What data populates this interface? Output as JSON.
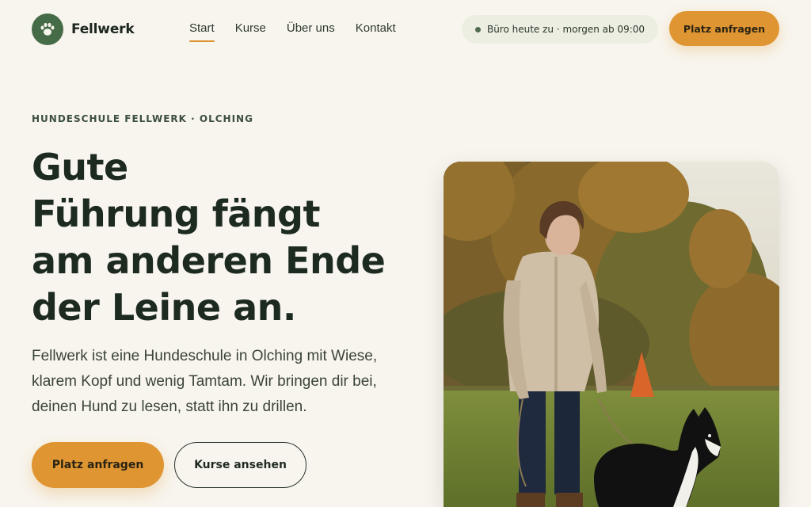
{
  "brand": {
    "name": "Fellwerk",
    "logo_icon": "paw-icon",
    "logo_color": "#466b47"
  },
  "nav": [
    {
      "label": "Start",
      "active": true
    },
    {
      "label": "Kurse",
      "active": false
    },
    {
      "label": "Über uns",
      "active": false
    },
    {
      "label": "Kontakt",
      "active": false
    }
  ],
  "status": {
    "text": "Büro heute zu · morgen ab 09:00",
    "dot_color": "#4f6b50"
  },
  "header_cta": {
    "label": "Platz anfragen"
  },
  "hero": {
    "eyebrow": "HUNDESCHULE FELLWERK · OLCHING",
    "headline_lines": [
      "Gute",
      "Führung fängt",
      "am anderen Ende",
      "der Leine an."
    ],
    "lead": "Fellwerk ist eine Hundeschule in Olching mit Wiese, klarem Kopf und wenig Tamtam. Wir bringen dir bei, deinen Hund zu lesen, statt ihn zu drillen.",
    "primary_cta": "Platz anfragen",
    "secondary_cta": "Kurse ansehen"
  },
  "colors": {
    "background": "#f8f5ee",
    "accent": "#df9632",
    "text_dark": "#1c2a1f",
    "green": "#466b47"
  }
}
